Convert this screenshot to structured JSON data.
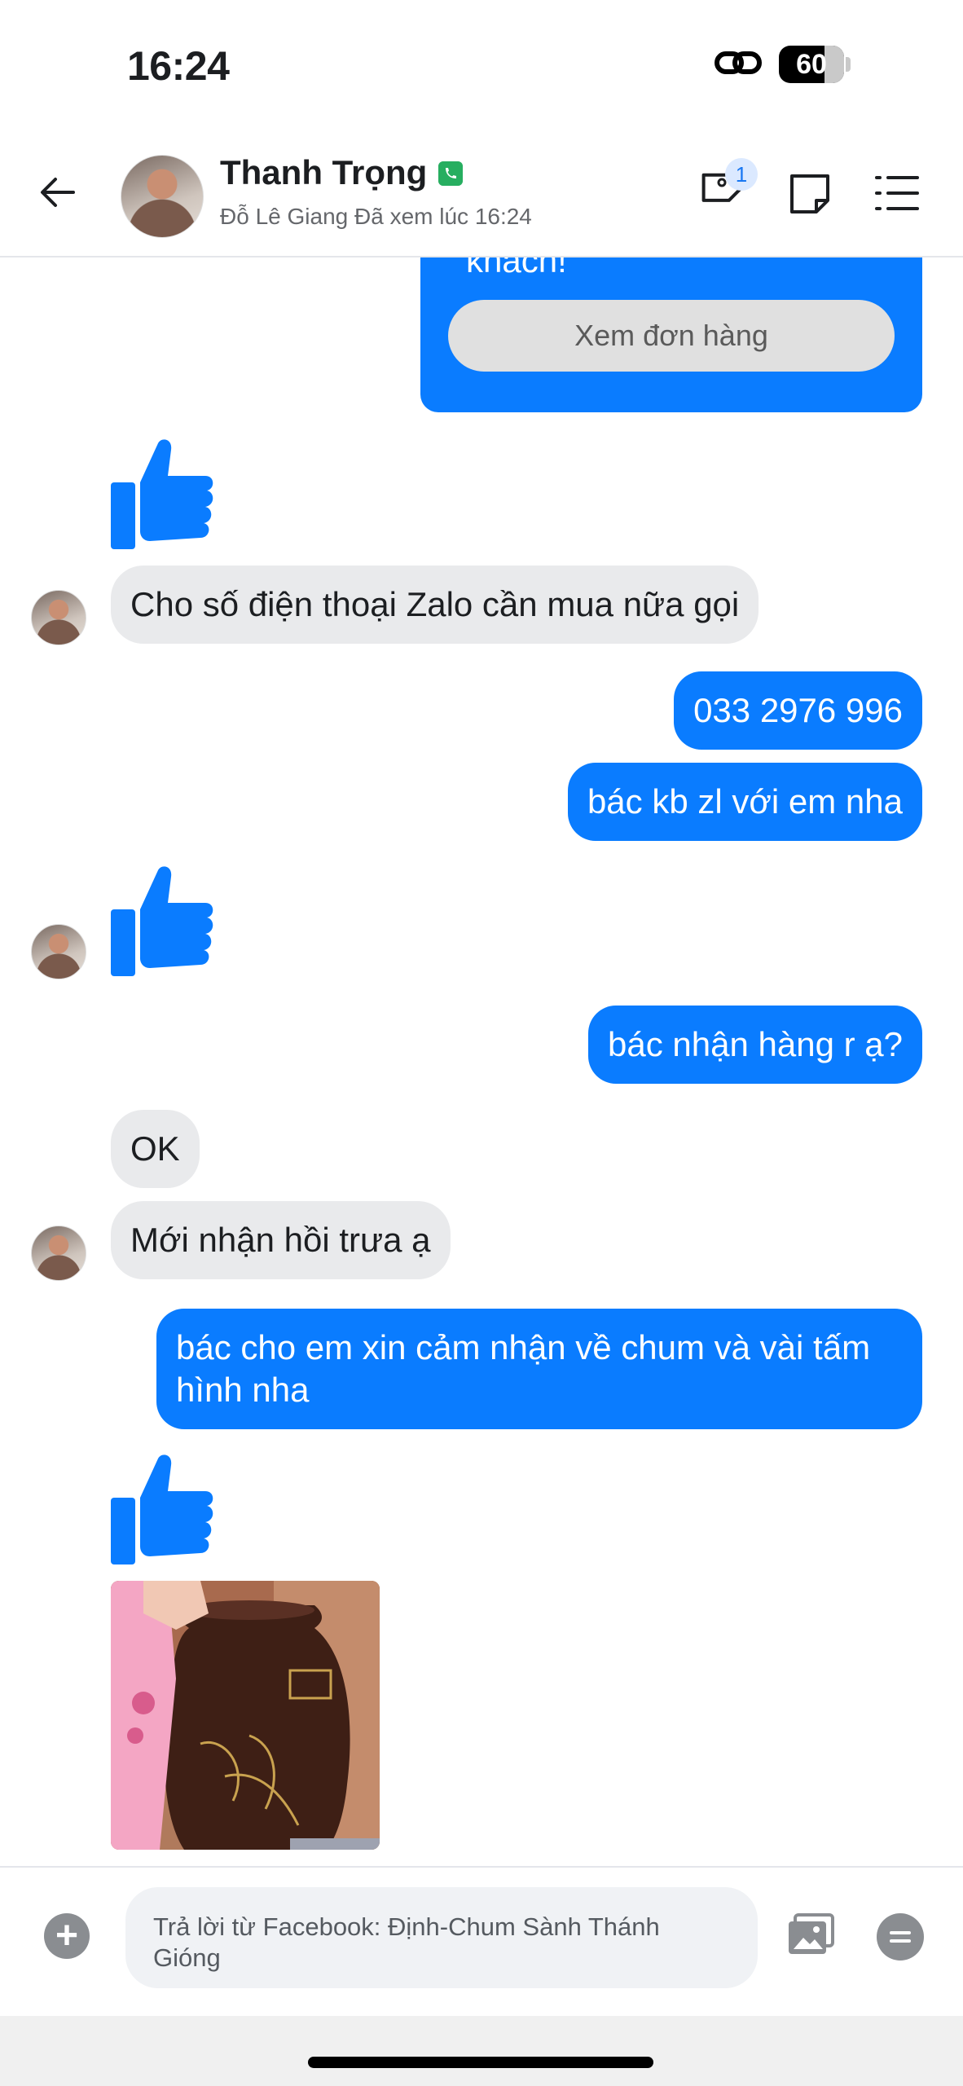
{
  "status_bar": {
    "time": "16:24",
    "battery": "60",
    "battery_level_percent": 60
  },
  "header": {
    "contact_name": "Thanh Trọng",
    "subtitle": "Đỗ Lê Giang Đã xem lúc 16:24",
    "tag_count": "1",
    "icons": [
      "back-arrow-icon",
      "phone-icon",
      "tag-icon",
      "note-icon",
      "list-icon"
    ]
  },
  "order_card": {
    "text": "khách!",
    "button_label": "Xem đơn hàng"
  },
  "messages": {
    "m1": "Cho số điện thoại Zalo cần mua nữa gọi",
    "m2": "033 2976 996",
    "m3": "bác kb zl với em nha",
    "m4": "bác nhận hàng r ạ?",
    "m5": "OK",
    "m6": "Mới nhận hồi trưa ạ",
    "m7": "bác cho em xin cảm nhận về chum và vài tấm hình nha"
  },
  "composer": {
    "placeholder": "Trả lời từ Facebook: Định-Chum Sành Thánh Gióng"
  },
  "colors": {
    "accent": "#0a7cff",
    "incoming_bubble": "#e9eaec",
    "like": "#0a7cff"
  }
}
